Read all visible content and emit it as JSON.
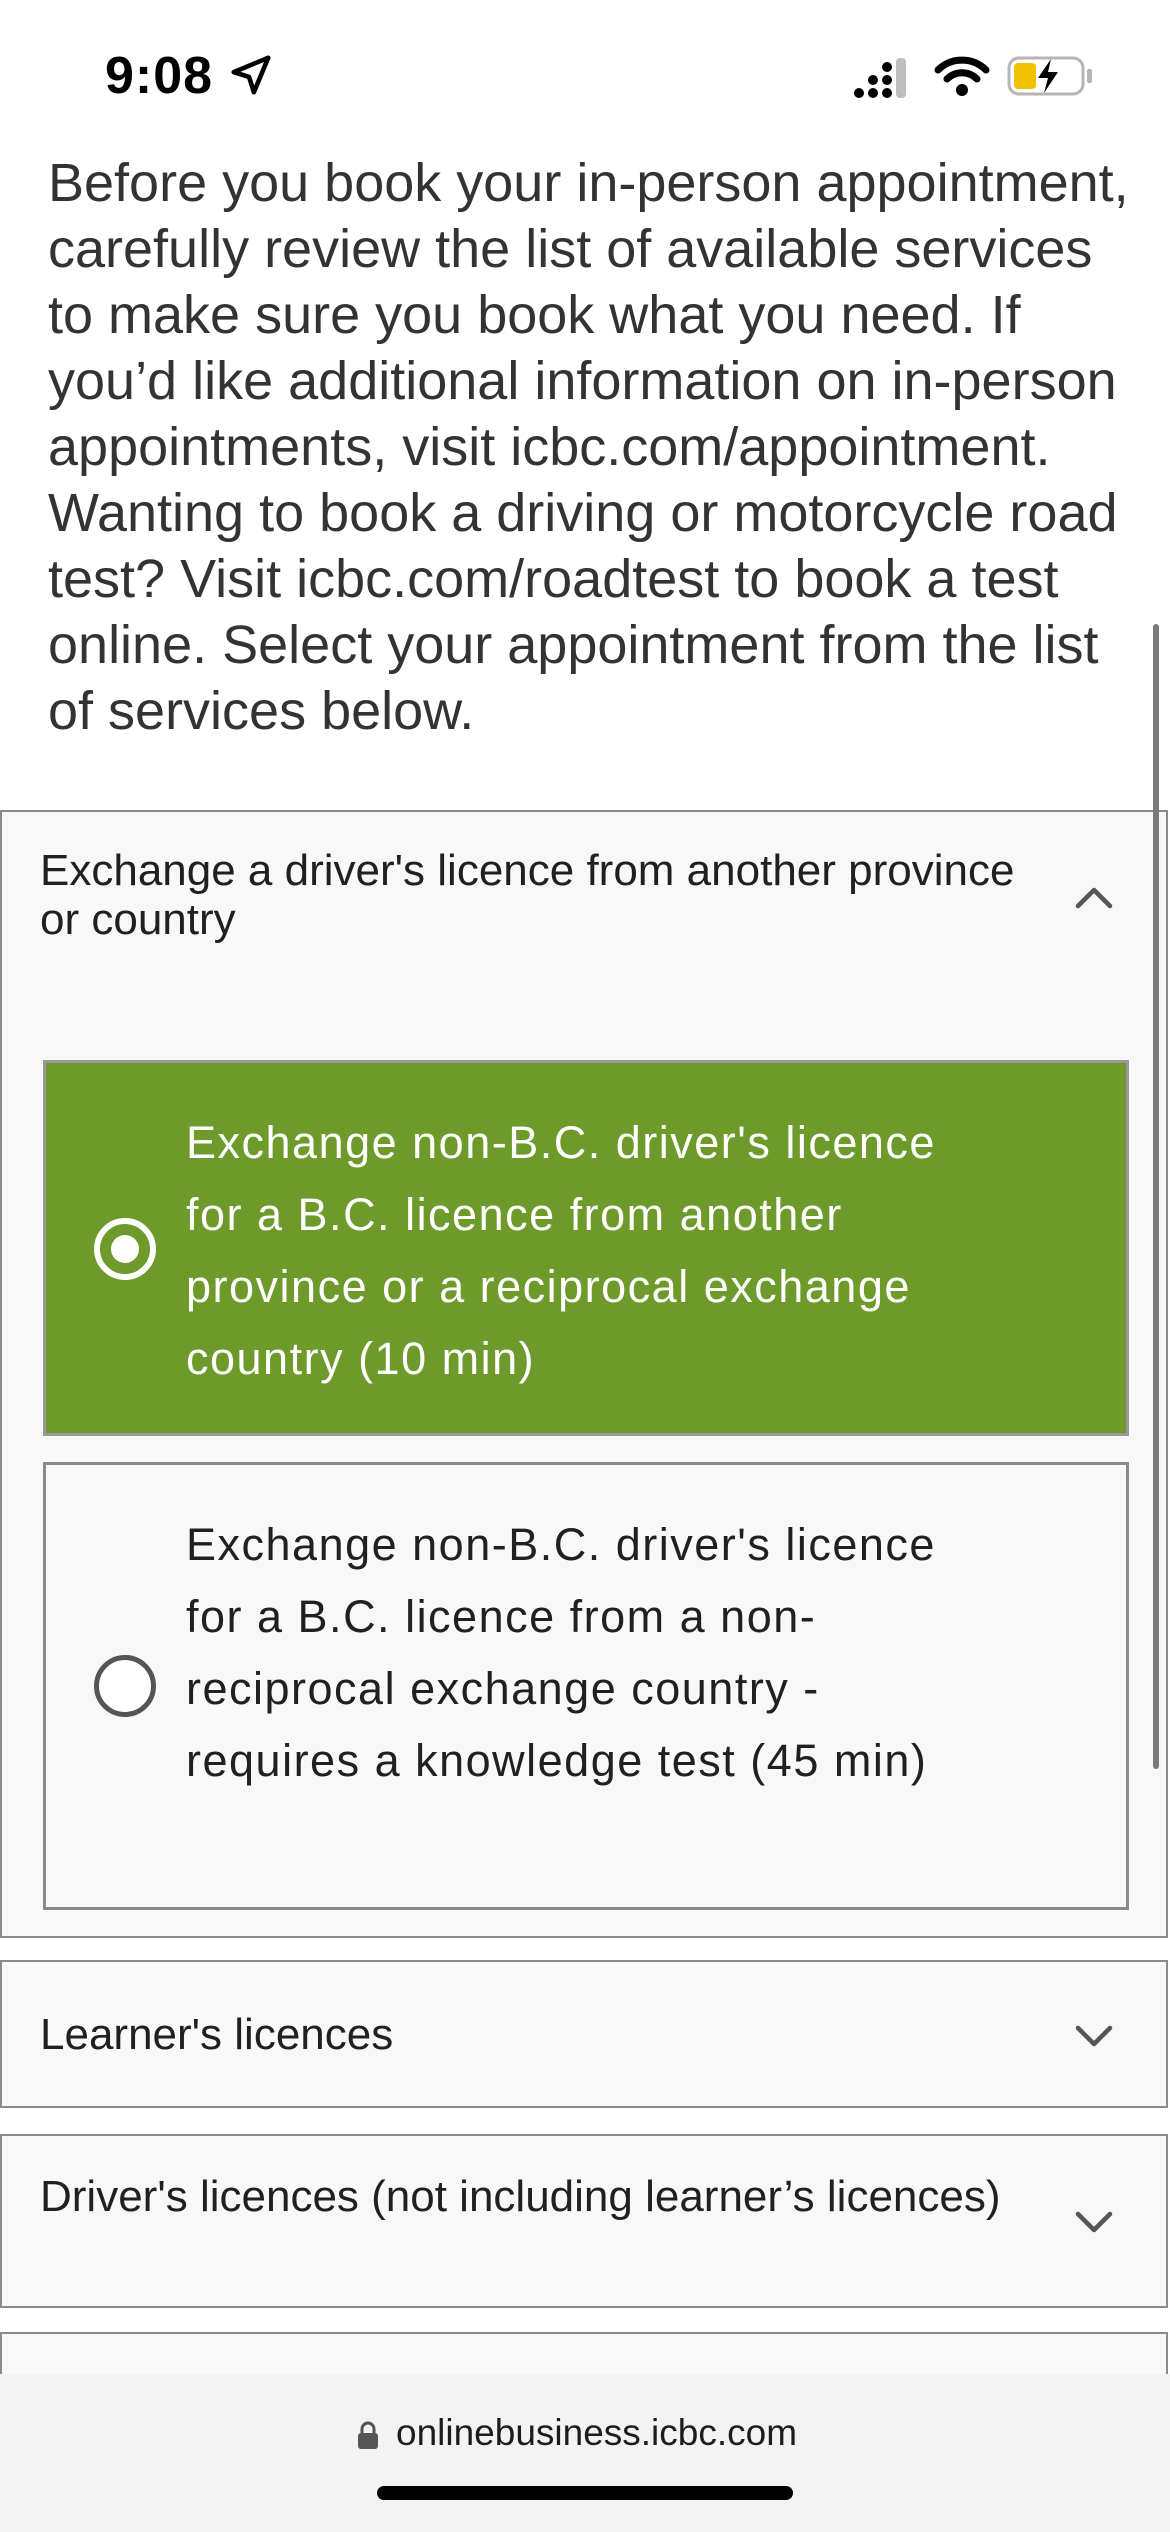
{
  "status_bar": {
    "time": "9:08",
    "icons": [
      "location-arrow-icon",
      "cellular-signal-icon",
      "wifi-icon",
      "battery-charging-icon"
    ]
  },
  "intro": {
    "text": "Before you book your in-person appointment, carefully review the list of available services to make sure you book what you need. If you’d like additional information on in-person appointments, visit icbc.com/appointment. Wanting to book a driving or motorcycle road test? Visit icbc.com/roadtest to book a test online. Select your appointment from the list of services below."
  },
  "accordions": [
    {
      "title": "Exchange a driver's licence from another province or country",
      "expanded": true,
      "options": [
        {
          "label": "Exchange non-B.C. driver's licence for a B.C. licence from another province or a reciprocal exchange country (10 min)",
          "selected": true
        },
        {
          "label": "Exchange non-B.C. driver's licence for a B.C. licence from a non-reciprocal exchange country - requires a knowledge test (45 min)",
          "selected": false
        }
      ]
    },
    {
      "title": "Learner's licences",
      "expanded": false
    },
    {
      "title": "Driver's licences (not including learner’s licences)",
      "expanded": false
    }
  ],
  "browser": {
    "url": "onlinebusiness.icbc.com"
  },
  "colors": {
    "selected_option_bg": "#6e9a2b",
    "accordion_bg": "#f8f8f8",
    "border": "#8a8a8a"
  }
}
